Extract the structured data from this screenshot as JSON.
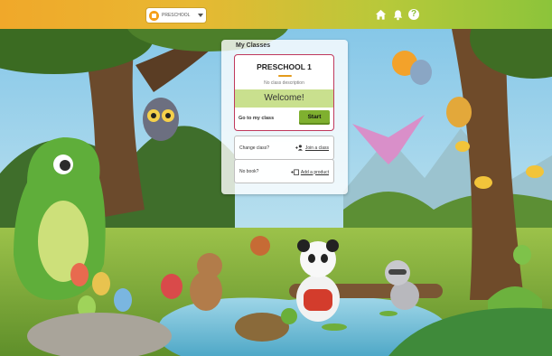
{
  "topbar": {
    "class_selector": {
      "label": "PRESCHOOL"
    },
    "icons": {
      "home": "home-icon",
      "notifications": "bell-icon",
      "help": "help-icon"
    },
    "help_glyph": "?"
  },
  "panel": {
    "title": "My Classes",
    "class_card": {
      "name": "PRESCHOOL 1",
      "description": "No class description",
      "welcome": "Welcome!",
      "go_link": "Go to my class",
      "start_button": "Start"
    },
    "change_class": {
      "label": "Change class?",
      "link": "Join a class"
    },
    "no_book": {
      "label": "No book?",
      "link": "Add a product"
    }
  },
  "colors": {
    "topbar_gradient": [
      "#f0a82a",
      "#8cc43a"
    ],
    "card_border": "#c0395d",
    "welcome_bg": "#c9e08e",
    "start_button": "#7fb02f",
    "accent_line": "#e39b1b"
  }
}
